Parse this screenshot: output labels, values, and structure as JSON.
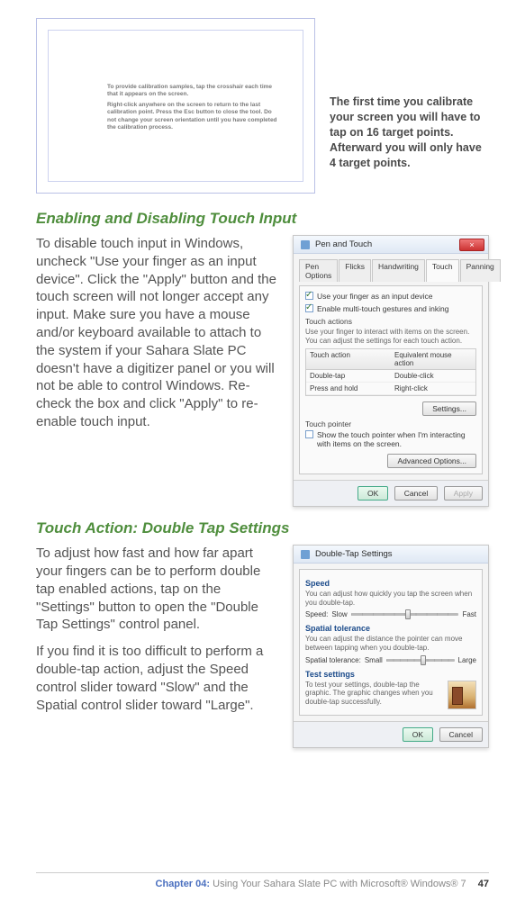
{
  "calibration": {
    "inner_line1": "To provide calibration samples, tap the crosshair each time that it appears on the screen.",
    "inner_line2": "Right-click anywhere on the screen to return to the last calibration point. Press the Esc button to close the tool. Do not change your screen orientation until you have completed the calibration process.",
    "caption": "The first time you calibrate your screen you will have to tap on 16 target points. Afterward you will only have 4 target points."
  },
  "section1": {
    "heading": "Enabling and Disabling Touch Input",
    "body": "To disable touch input in Windows, uncheck \"Use your finger as an input device\". Click the \"Apply\" button and the touch screen will not longer accept any input. Make sure you have a mouse and/or keyboard available to attach to the system if your Sahara Slate PC doesn't have a digitizer panel or you will not be able to control Windows. Re-check the box and click \"Apply\" to re-enable touch input."
  },
  "dialog1": {
    "title": "Pen and Touch",
    "tabs": [
      "Pen Options",
      "Flicks",
      "Handwriting",
      "Touch",
      "Panning"
    ],
    "check1": "Use your finger as an input device",
    "check2": "Enable multi-touch gestures and inking",
    "group_actions": "Touch actions",
    "actions_hint": "Use your finger to interact with items on the screen. You can adjust the settings for each touch action.",
    "col1": "Touch action",
    "col2": "Equivalent mouse action",
    "row1a": "Double-tap",
    "row1b": "Double-click",
    "row2a": "Press and hold",
    "row2b": "Right-click",
    "settings_btn": "Settings...",
    "group_pointer": "Touch pointer",
    "pointer_check": "Show the touch pointer when I'm interacting with items on the screen.",
    "adv_btn": "Advanced Options...",
    "ok": "OK",
    "cancel": "Cancel",
    "apply": "Apply"
  },
  "section2": {
    "heading": "Touch Action: Double Tap Settings",
    "p1": "To adjust how fast and how far apart your fingers can be to perform double tap enabled actions, tap on the \"Settings\" button to open the \"Double Tap Settings\" control panel.",
    "p2": "If you find it is too difficult to perform a double-tap action, adjust the Speed control slider toward \"Slow\" and the Spatial control slider toward \"Large\"."
  },
  "dialog2": {
    "title": "Double-Tap Settings",
    "grp_speed": "Speed",
    "speed_hint": "You can adjust how quickly you tap the screen when you double-tap.",
    "speed_label": "Speed:",
    "slow": "Slow",
    "fast": "Fast",
    "grp_spatial": "Spatial tolerance",
    "spatial_hint": "You can adjust the distance the pointer can move between tapping when you double-tap.",
    "spatial_label": "Spatial tolerance:",
    "small": "Small",
    "large": "Large",
    "grp_test": "Test settings",
    "test_hint": "To test your settings, double-tap the graphic. The graphic changes when you double-tap successfully.",
    "ok": "OK",
    "cancel": "Cancel"
  },
  "footer": {
    "chapter": "Chapter 04:",
    "title": "Using Your Sahara Slate PC with Microsoft® Windows® 7",
    "page": "47"
  }
}
